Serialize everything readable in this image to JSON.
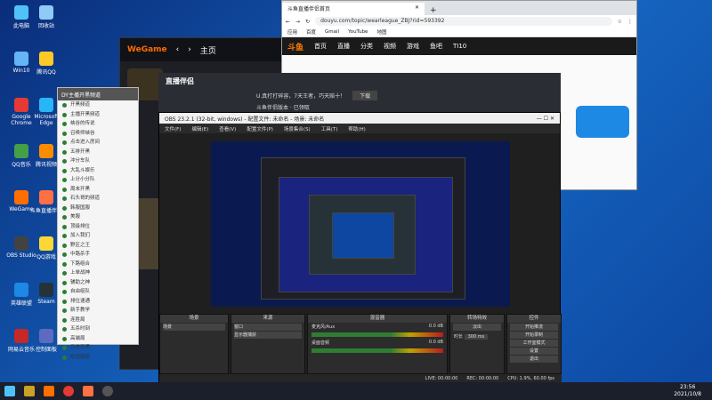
{
  "desktop": {
    "icons": [
      {
        "label": "此电脑",
        "color": "#4fc3f7"
      },
      {
        "label": "回收站",
        "color": "#90caf9"
      },
      {
        "label": "Win10",
        "color": "#64b5f6"
      },
      {
        "label": "腾讯QQ",
        "color": "#ffca28"
      },
      {
        "label": "Google Chrome",
        "color": "#e53935"
      },
      {
        "label": "Microsoft Edge",
        "color": "#29b6f6"
      },
      {
        "label": "QQ音乐",
        "color": "#43a047"
      },
      {
        "label": "腾讯视频",
        "color": "#fb8c00"
      },
      {
        "label": "WeGame",
        "color": "#ff6f00"
      },
      {
        "label": "斗鱼直播伴侣",
        "color": "#ff7043"
      },
      {
        "label": "OBS Studio",
        "color": "#424242"
      },
      {
        "label": "QQ游戏",
        "color": "#fdd835"
      },
      {
        "label": "英雄联盟",
        "color": "#1e88e5"
      },
      {
        "label": "Steam",
        "color": "#263238"
      },
      {
        "label": "网易云音乐",
        "color": "#c62828"
      },
      {
        "label": "控制面板",
        "color": "#5c6bc0"
      }
    ]
  },
  "chrome": {
    "tab_title": "斗鱼直播伴侣首页",
    "url": "douyu.com/topic/wearleague_ZBJ?rid=593392",
    "bookmarks": [
      "应用",
      "百度",
      "Gmail",
      "YouTube",
      "地图"
    ],
    "site_nav": [
      "首页",
      "直播",
      "分类",
      "视频",
      "游戏",
      "鱼吧",
      "TI10"
    ],
    "site_logo": "斗鱼"
  },
  "wegame": {
    "logo": "WeGame",
    "home": "主页"
  },
  "douyu_companion": {
    "logo": "直播伴侣",
    "notice": "U.真打打碎容，7天王者，巧天赔十！",
    "btn": "下载",
    "info": "斗鱼伴侣版本 · 已领取"
  },
  "dy_chat": {
    "title": "DY主播开黑频道",
    "items": [
      "开黑频道",
      "主播开黑频道",
      "峡谷的传说",
      "召唤师峡谷",
      "点击进入房间",
      "五排开黑",
      "冲分车队",
      "大乱斗娱乐",
      "上分小分队",
      "周末开黑",
      "石头哥的频道",
      "韩服国服",
      "美服",
      "顶级排位",
      "加入我们",
      "野区之王",
      "中路杀手",
      "下路组合",
      "上单战神",
      "辅助之神",
      "自由组队",
      "排位速通",
      "新手教学",
      "连胜局",
      "五杀时刻",
      "高端局",
      "日常开黑",
      "吃鸡频道"
    ]
  },
  "obs": {
    "title": "OBS 23.2.1 (32-bit, windows) - 配置文件: 未命名 - 场景: 未命名",
    "menu": [
      "文件(F)",
      "编辑(E)",
      "查看(V)",
      "配置文件(P)",
      "场景集合(S)",
      "工具(T)",
      "帮助(H)"
    ],
    "docks": {
      "scenes": {
        "title": "场景",
        "items": [
          "场景"
        ]
      },
      "sources": {
        "title": "来源",
        "items": [
          "窗口",
          "显示器捕获"
        ]
      },
      "mixer": {
        "title": "混音器",
        "tracks": [
          "麦克风/Aux",
          "桌面音频"
        ],
        "db": [
          "0.0 dB",
          "0.0 dB"
        ]
      },
      "transitions": {
        "title": "转场特效",
        "fade": "淡出",
        "duration_label": "时长",
        "duration": "300 ms"
      },
      "controls": {
        "title": "控件",
        "buttons": [
          "开始推流",
          "开始录制",
          "工作室模式",
          "设置",
          "退出"
        ]
      }
    },
    "status": [
      "LIVE: 00:00:00",
      "REC: 00:00:00",
      "CPU: 1.9%, 60.00 fps"
    ]
  },
  "taskbar": {
    "time": "23:56",
    "date": "2021/10/8"
  }
}
